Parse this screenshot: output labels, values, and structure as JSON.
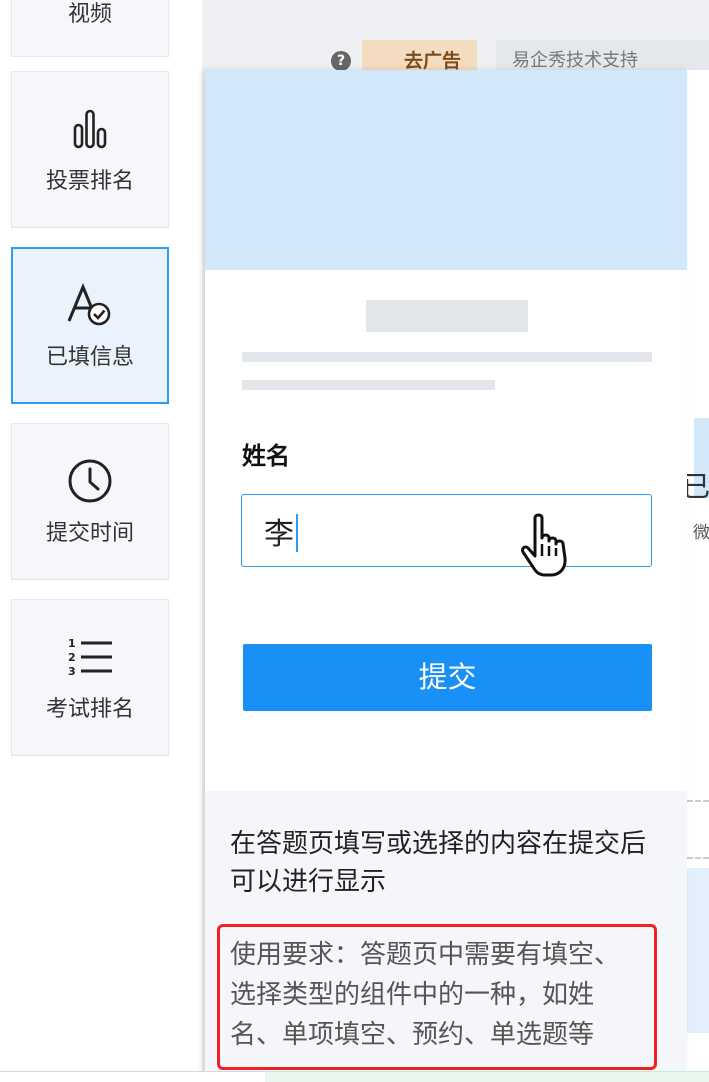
{
  "sidebar": {
    "items": [
      {
        "label": "视频",
        "icon": "video-icon"
      },
      {
        "label": "投票排名",
        "icon": "bar-chart-icon"
      },
      {
        "label": "已填信息",
        "icon": "filled-info-icon",
        "selected": true
      },
      {
        "label": "提交时间",
        "icon": "clock-icon"
      },
      {
        "label": "考试排名",
        "icon": "numbered-list-icon"
      }
    ]
  },
  "header": {
    "help_icon": "?",
    "ad_label": "去广告",
    "support_label": "易企秀技术支持"
  },
  "preview": {
    "field_label": "姓名",
    "name_value": "李",
    "submit_label": "提交",
    "description": "在答题页填写或选择的内容在提交后可以进行显示",
    "requirement": "使用要求：答题页中需要有填空、选择类型的组件中的一种，如姓名、单项填空、预约、单选题等"
  },
  "right_partial": {
    "glyph1": "已",
    "glyph2": "微"
  },
  "colors": {
    "accent": "#1890f5",
    "selected_border": "#2d9bf0",
    "highlight_border": "#ee2222",
    "banner": "#d3e7fb"
  }
}
